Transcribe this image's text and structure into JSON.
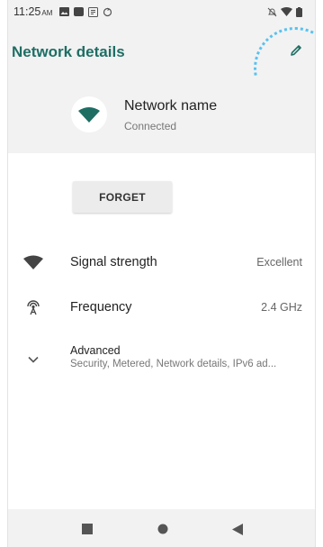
{
  "status_bar": {
    "time": "11:25",
    "ampm": "AM"
  },
  "toolbar": {
    "title": "Network details",
    "edit_icon": "pencil-icon"
  },
  "network": {
    "name": "Network name",
    "status": "Connected",
    "icon": "wifi-icon"
  },
  "actions": {
    "forget_label": "FORGET"
  },
  "details": {
    "signal": {
      "label": "Signal strength",
      "value": "Excellent",
      "icon": "wifi-signal-icon"
    },
    "frequency": {
      "label": "Frequency",
      "value": "2.4 GHz",
      "icon": "antenna-icon"
    },
    "advanced": {
      "label": "Advanced",
      "summary": "Security, Metered, Network details, IPv6 ad...",
      "icon": "chevron-down-icon"
    }
  },
  "colors": {
    "accent": "#1e6e64",
    "surface": "#f2f2f2",
    "tap_highlight": "#58c2f0"
  }
}
